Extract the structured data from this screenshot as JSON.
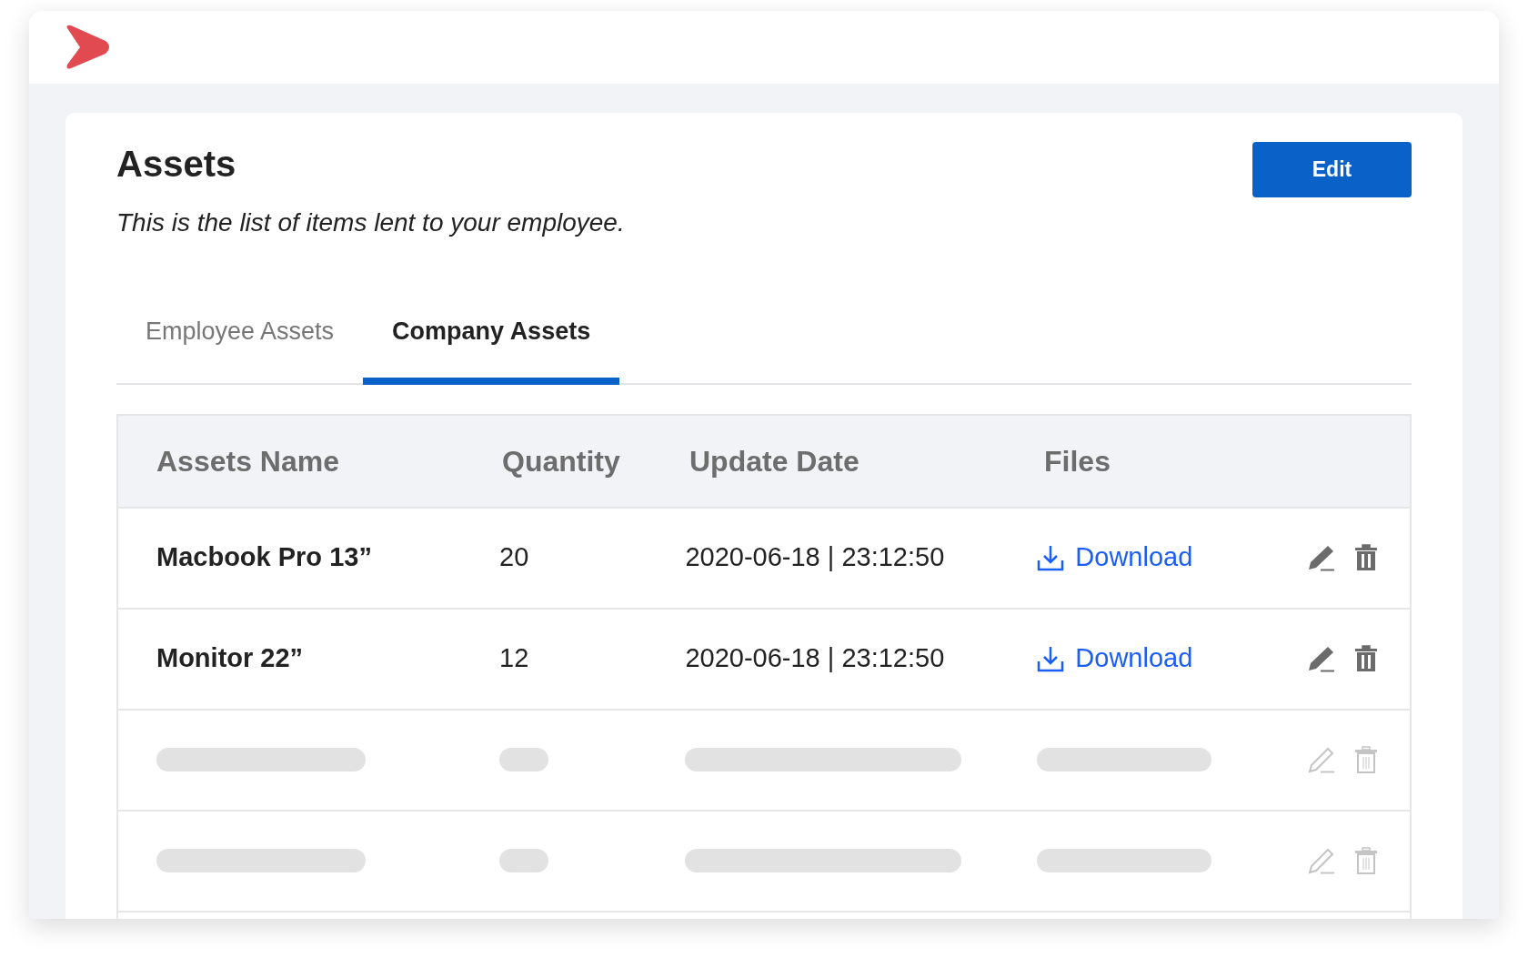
{
  "page": {
    "title": "Assets",
    "subtitle": "This is the list of items lent to your employee.",
    "edit_button": "Edit"
  },
  "tabs": [
    {
      "label": "Employee Assets",
      "selected": false
    },
    {
      "label": "Company Assets",
      "selected": true
    }
  ],
  "table": {
    "columns": [
      "Assets Name",
      "Quantity",
      "Update Date",
      "Files"
    ],
    "rows": [
      {
        "kind": "data",
        "name": "Macbook Pro 13”",
        "quantity": "20",
        "date": "2020-06-18 | 23:12:50",
        "file": "Download"
      },
      {
        "kind": "data",
        "name": "Monitor 22”",
        "quantity": "12",
        "date": "2020-06-18 | 23:12:50",
        "file": "Download"
      },
      {
        "kind": "skeleton"
      },
      {
        "kind": "skeleton"
      }
    ]
  }
}
